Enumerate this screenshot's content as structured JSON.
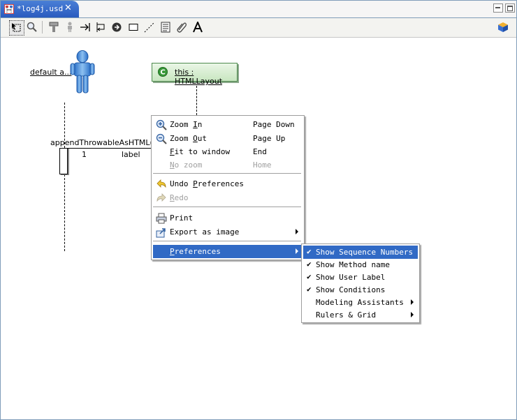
{
  "editor": {
    "tab_title": "*log4j.usd"
  },
  "toolbar": {
    "tools": [
      "select",
      "zoom",
      "lifeline",
      "actor",
      "message",
      "self-message",
      "return",
      "note",
      "note-link",
      "documentation",
      "attachment",
      "text"
    ]
  },
  "diagram": {
    "actor_label": "default a...",
    "class_label": "this : HTMLLayout",
    "message_label": "appendThrowableAsHTML(St",
    "sequence_number": "1",
    "user_label": "label"
  },
  "context_menu": {
    "items": [
      {
        "label": "Zoom In",
        "mnemonic": "I",
        "accel": "Page Down",
        "icon": "zoom-in-icon",
        "enabled": true
      },
      {
        "label": "Zoom Out",
        "mnemonic": "O",
        "accel": "Page Up",
        "icon": "zoom-out-icon",
        "enabled": true
      },
      {
        "label": "Fit to window",
        "mnemonic": "F",
        "accel": "End",
        "enabled": true
      },
      {
        "label": "No zoom",
        "mnemonic": "N",
        "accel": "Home",
        "enabled": false
      },
      {
        "label": "Undo Preferences",
        "mnemonic": "P",
        "icon": "undo-icon",
        "enabled": true
      },
      {
        "label": "Redo",
        "mnemonic": "R",
        "icon": "redo-icon",
        "enabled": false
      },
      {
        "label": "Print",
        "icon": "printer-icon",
        "enabled": true
      },
      {
        "label": "Export as image",
        "icon": "export-icon",
        "enabled": true,
        "submenu": true
      },
      {
        "label": "Preferences",
        "mnemonic": "P",
        "enabled": true,
        "submenu": true,
        "highlighted": true
      }
    ]
  },
  "preferences_submenu": {
    "items": [
      {
        "label": "Show Sequence Numbers",
        "checked": true,
        "highlighted": true
      },
      {
        "label": "Show Method name",
        "checked": true
      },
      {
        "label": "Show User Label",
        "checked": true
      },
      {
        "label": "Show Conditions",
        "checked": true
      },
      {
        "label": "Modeling Assistants",
        "checked": false,
        "submenu": true
      },
      {
        "label": "Rulers & Grid",
        "checked": false,
        "submenu": true
      }
    ],
    "check_glyph": "✔"
  },
  "colors": {
    "tab_active": "#2a5bbf",
    "menu_highlight": "#316ac5",
    "class_box_border": "#4d8a4d",
    "class_box_fill": "#c8e6c0",
    "actor_blue": "#4a90d9"
  }
}
